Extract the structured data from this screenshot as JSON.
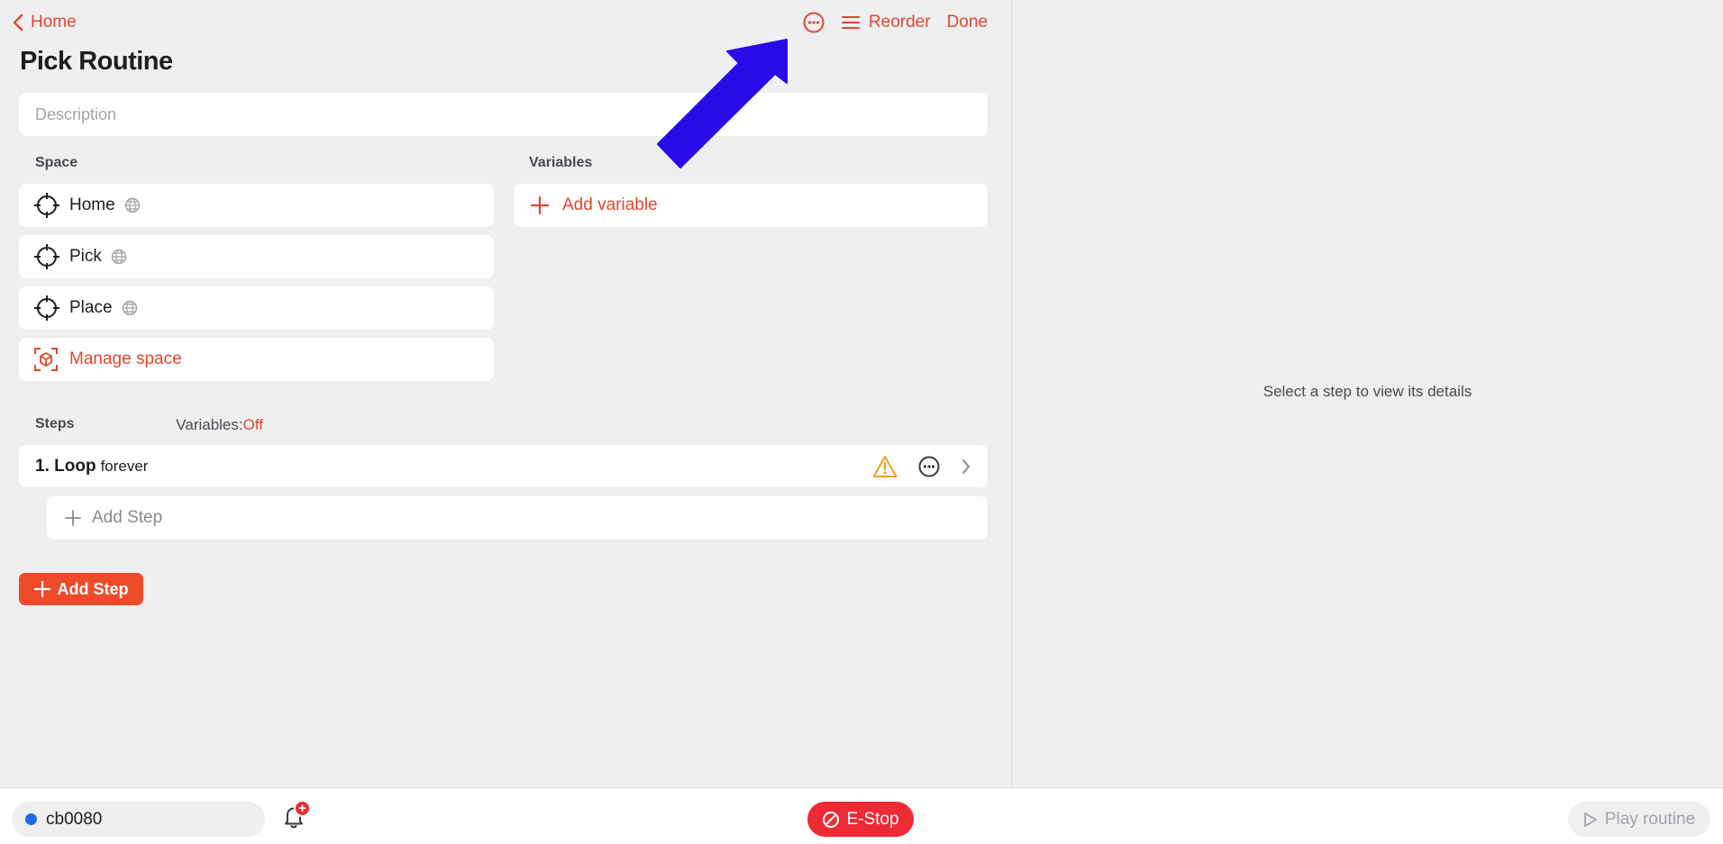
{
  "nav": {
    "back_label": "Home",
    "reorder_label": "Reorder",
    "done_label": "Done"
  },
  "routine": {
    "title": "Pick Routine",
    "description_placeholder": "Description"
  },
  "space": {
    "section_label": "Space",
    "items": [
      {
        "label": "Home"
      },
      {
        "label": "Pick"
      },
      {
        "label": "Place"
      }
    ],
    "manage_label": "Manage space"
  },
  "variables": {
    "section_label": "Variables",
    "add_label": "Add variable"
  },
  "steps": {
    "section_label": "Steps",
    "variables_toggle_label": "Variables:",
    "variables_toggle_value": "Off",
    "items": [
      {
        "name": "1. Loop",
        "detail": "forever"
      }
    ],
    "nested_add_label": "Add Step",
    "add_button_label": "Add Step"
  },
  "details_panel": {
    "empty_text": "Select a step to view its details"
  },
  "bottom_bar": {
    "robot_name": "cb0080",
    "robot_status_color": "#1a6ee8",
    "notification_badge": "+",
    "estop_label": "E-Stop",
    "play_label": "Play routine"
  },
  "colors": {
    "accent": "#e2472b",
    "button": "#ee4b2b",
    "estop": "#ee2a35",
    "warning": "#f0a020",
    "annotation_arrow": "#2a0ae8"
  },
  "icons": [
    "chevron-left-icon",
    "more-options-icon",
    "menu-lines-icon",
    "crosshair-icon",
    "globe-icon",
    "plus-icon",
    "cube-scan-icon",
    "warning-icon",
    "chevron-right-icon",
    "bell-icon",
    "ban-icon",
    "play-icon",
    "arrow-annotation"
  ]
}
